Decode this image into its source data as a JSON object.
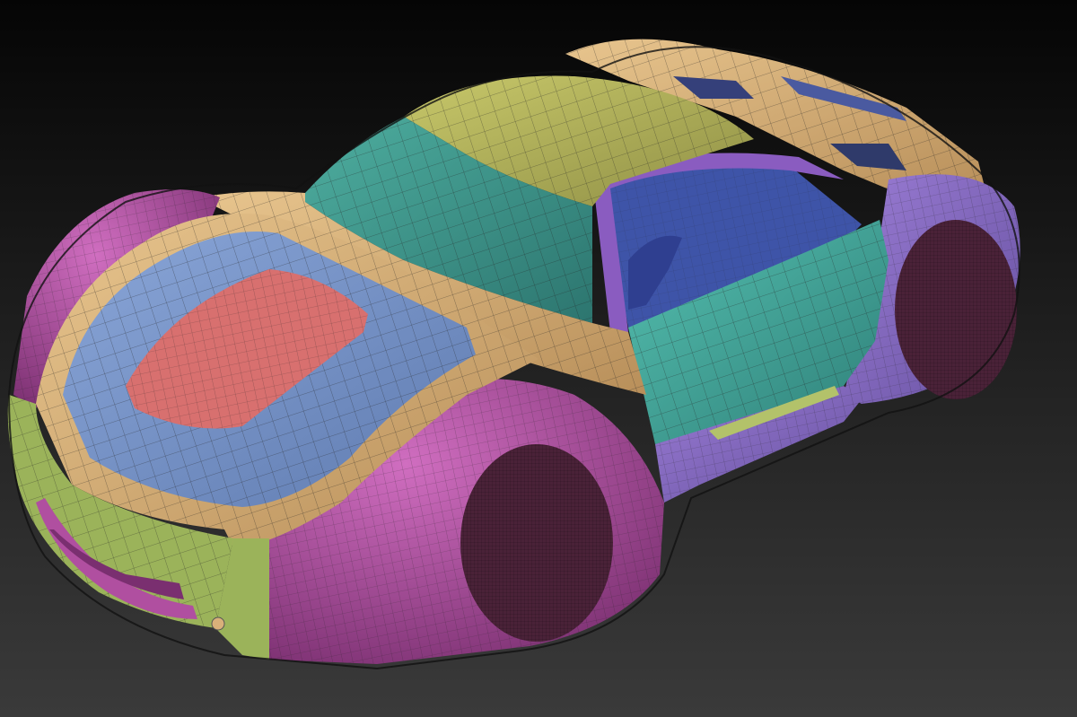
{
  "viewport": {
    "background_top": "#050505",
    "background_bottom": "#3a3a3a"
  },
  "model": {
    "polygroup_colors": {
      "body_magenta": "#b04fa0",
      "trim_tan": "#d9b07a",
      "hood_blue": "#6f8ec4",
      "hood_panel_red": "#d8706f",
      "roof_olive": "#b3b35a",
      "glass_teal": "#3fa39a",
      "door_teal": "#3f9e8f",
      "side_purple": "#8a6cc4",
      "bumper_green": "#9bb35a",
      "tire_dark": "#4a2238",
      "wire": "#2a2a2a"
    }
  }
}
